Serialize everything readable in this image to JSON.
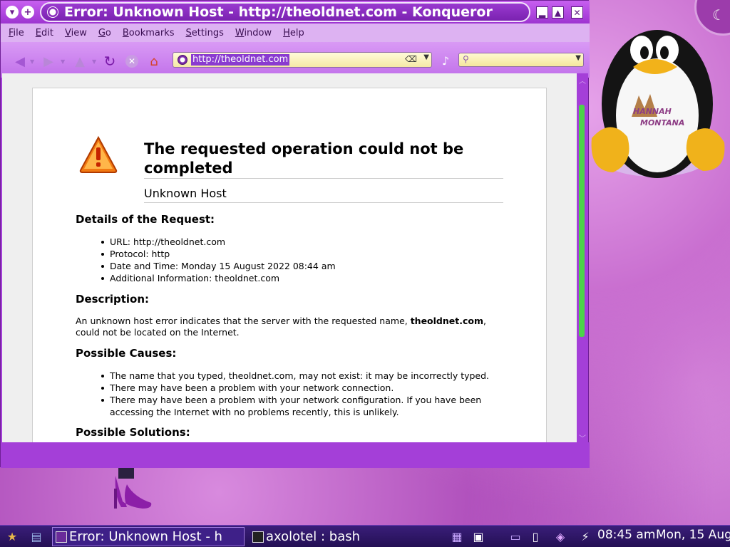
{
  "window": {
    "title": "Error: Unknown Host - http://theoldnet.com - Konqueror",
    "buttons": {
      "menu": "▾",
      "sticky": "+",
      "minimize": "▂",
      "maximize": "▲",
      "close": "✕"
    }
  },
  "menu": [
    "File",
    "Edit",
    "View",
    "Go",
    "Bookmarks",
    "Settings",
    "Window",
    "Help"
  ],
  "toolbar": {
    "url": "http://theoldnet.com",
    "icons": [
      "back-icon",
      "forward-icon",
      "up-icon",
      "reload-icon",
      "stop-icon",
      "home-icon",
      "go-icon",
      "search-icon"
    ]
  },
  "page": {
    "headline": "The requested operation could not be completed",
    "subhead": "Unknown Host",
    "details_heading": "Details of the Request:",
    "details": [
      "URL: http://theoldnet.com",
      "Protocol: http",
      "Date and Time: Monday 15 August 2022 08:44 am",
      "Additional Information: theoldnet.com"
    ],
    "description_heading": "Description:",
    "description_pre": "An unknown host error indicates that the server with the requested name, ",
    "description_bold": "theoldnet.com",
    "description_post": ", could not be located on the Internet.",
    "causes_heading": "Possible Causes:",
    "causes": [
      "The name that you typed, theoldnet.com, may not exist: it may be incorrectly typed.",
      "There may have been a problem with your network connection.",
      "There may have been a problem with your network configuration. If you have been accessing the Internet with no problems recently, this is unlikely."
    ],
    "solutions_heading": "Possible Solutions:"
  },
  "desktop": {
    "mascot_text": "HANNAH MONTANA"
  },
  "taskbar": {
    "tasks": [
      {
        "label": "Error: Unknown Host - h",
        "active": true
      },
      {
        "label": "axolotel : bash",
        "active": false
      }
    ],
    "clock": "08:45 am",
    "date": "Mon, 15 Aug"
  },
  "colors": {
    "window_purple": "#a43fd8",
    "titlebar": "#9d34d1",
    "desktop": "#b453c2",
    "scroll_thumb": "#4cd34a"
  }
}
